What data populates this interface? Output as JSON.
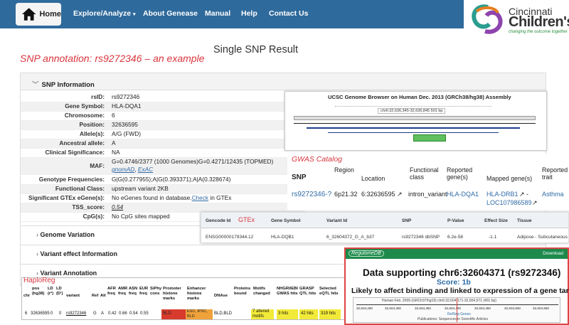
{
  "nav": {
    "home": "Home",
    "items": [
      "Explore/Analyze",
      "About Genease",
      "Manual",
      "Help",
      "Contact Us"
    ]
  },
  "logo": {
    "line1": "Cincinnati",
    "line2": "Children's",
    "tagline": "changing the outcome together"
  },
  "page": {
    "title": "Single SNP Result"
  },
  "annotation": {
    "prefix": "SNP annotation: ",
    "rsid": "rs9272346",
    "suffix": " – an example"
  },
  "snp_info": {
    "header": "SNP Information",
    "rows": [
      {
        "k": "rsID:",
        "v": "rs9272346"
      },
      {
        "k": "Gene Symbol:",
        "v": "HLA-DQA1"
      },
      {
        "k": "Chromosome:",
        "v": "6"
      },
      {
        "k": "Position:",
        "v": "32636595"
      },
      {
        "k": "Allele(s):",
        "v": "A/G (FWD)"
      },
      {
        "k": "Ancestral allele:",
        "v": "A"
      },
      {
        "k": "Clinical Significance:",
        "v": "NA"
      },
      {
        "k": "MAF:",
        "v": "G=0.4746/2377 (1000 Genomes)G=0.4271/12435 (TOPMED)"
      },
      {
        "k": "Genotype Frequencies:",
        "v": "G|G(0.277955);A|G(0.393371);A|A(0.328674)"
      },
      {
        "k": "Functional Class:",
        "v": "upstream variant 2KB"
      },
      {
        "k": "Significant GTEx eGene(s):",
        "v": "No eGenes found in database."
      },
      {
        "k": "TSS_score:",
        "v": "0.54"
      },
      {
        "k": "CpG(s):",
        "v": "No CpG sites mapped"
      }
    ],
    "maf_links": [
      "gnomAD",
      "ExAC"
    ],
    "gtex_check": "Check",
    "gtex_tail": " in GTEx"
  },
  "sections": [
    "Genome Variation",
    "Variant effect Information",
    "Variant Annotation"
  ],
  "ucsc": {
    "title": "UCSC Genome Browser on Human Dec. 2013 (GRCh38/hg38) Assembly",
    "coords": "chr6:32,636,345-32,636,845 501 bp"
  },
  "gwas": {
    "title": "GWAS Catalog",
    "headers": [
      "SNP",
      "Region",
      "Location",
      "Functional class",
      "Reported gene(s)",
      "Mapped gene(s)",
      "Reported trait"
    ],
    "row": {
      "snp": "rs9272346-?",
      "region": "6p21.32",
      "location": "6:32636595",
      "fclass": "intron_variant",
      "reported": "HLA-DQA1",
      "mapped1": "HLA-DRB1",
      "mapped2": "LOC107986589",
      "trait": "Asthma"
    }
  },
  "gtex": {
    "label": "GTEx",
    "headers": [
      "Gencode Id",
      "Gene Symbol",
      "Variant Id",
      "SNP",
      "P-Value",
      "Effect Size",
      "Tissue"
    ],
    "row": {
      "gencode": "ENSG00000179344.12",
      "gene": "HLA-DQB1",
      "variant": "6_32604372_G_A_b37",
      "snp": "rs9272346 dbSNP",
      "p": "6.2e-58",
      "effect": "-1.1",
      "tissue": "Adipose - Subcutaneous"
    }
  },
  "regulome": {
    "brand": "RegulomeDB",
    "download": "Download",
    "heading": "Data supporting chr6:32604371 (rs9272346)",
    "score": "Score: 1b",
    "subheading": "Likely to affect binding and linked to expression of a gene target",
    "browser_caption": "Human Feb. 2009 (GRCh37/hg19) chr6:32,604,171-32,604,571 (401 bp)",
    "ticks": [
      "32,604,250",
      "32,604,300",
      "32,604,350",
      "32,604,400",
      "32,604,450",
      "32,604,500",
      "32,604,550"
    ],
    "track": "RefSeq Genes",
    "pubs": "Publications: Sequences in Scientific Articles"
  },
  "haploreg": {
    "title": "HaploReg",
    "headers": [
      "chr",
      "pos (hg38)",
      "LD (r²)",
      "LD (D')",
      "variant",
      "Ref",
      "Alt",
      "AFR freq",
      "AMR freq",
      "ASN freq",
      "EUR freq",
      "SiPhy cons",
      "Promoter histone marks",
      "Enhancer histone marks",
      "DNAse",
      "Proteins bound",
      "Motifs changed",
      "NHGRI/EBI GWAS hits",
      "GRASP QTL hits",
      "Selected eQTL hits"
    ],
    "row": [
      "6",
      "32636595",
      "0",
      "0",
      "rs9272346",
      "G",
      "A",
      "0.42",
      "0.66",
      "0.54",
      "0.55",
      "",
      "BLD",
      "ESC, IPSC, BLD",
      "BLD,BLD",
      "",
      "7 altered motifs",
      "3 hits",
      "42 hits",
      "319 hits"
    ]
  },
  "colors": {
    "nav": "#2f6a9c",
    "accent_red": "#d9363e",
    "regulome_green": "#1d8a4c",
    "link": "#2f6aa6",
    "promoter": "#d83b2d",
    "enhancer": "#f0a23a",
    "hits": "#f2ea38"
  }
}
